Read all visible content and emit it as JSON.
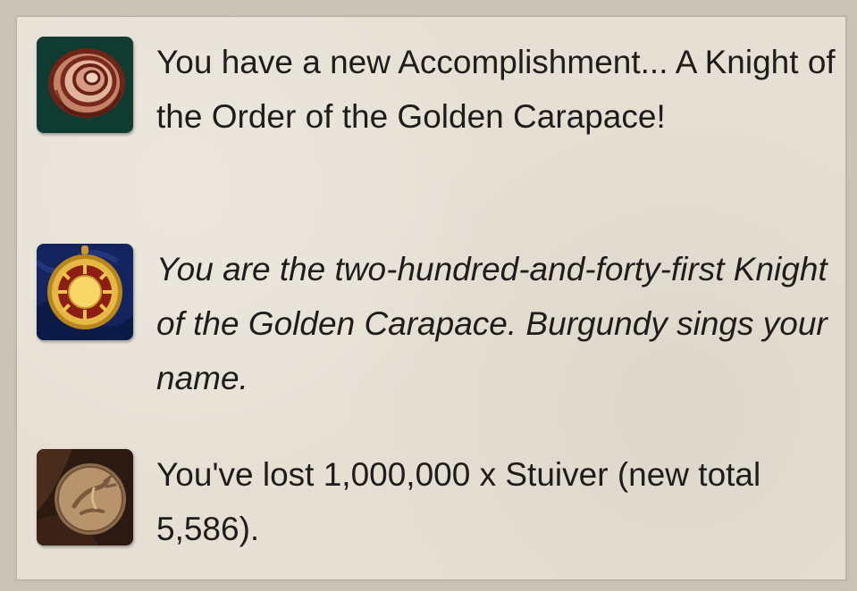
{
  "messages": [
    {
      "icon": "snail-shell-icon",
      "text": "You have a new Accomplishment... A Knight of the Order of the Golden Carapace!",
      "italic": false
    },
    {
      "icon": "golden-sun-medal-icon",
      "text": "You are the two-hundred-and-forty-first Knight of the Golden Carapace. Burgundy sings your name.",
      "italic": true
    },
    {
      "icon": "stuiver-coin-icon",
      "text": "You've lost 1,000,000 x Stuiver (new total 5,586).",
      "italic": false
    }
  ],
  "colors": {
    "background": "#c9c3b6",
    "panel": "#e6e0d4",
    "text": "#1e1d1b"
  }
}
